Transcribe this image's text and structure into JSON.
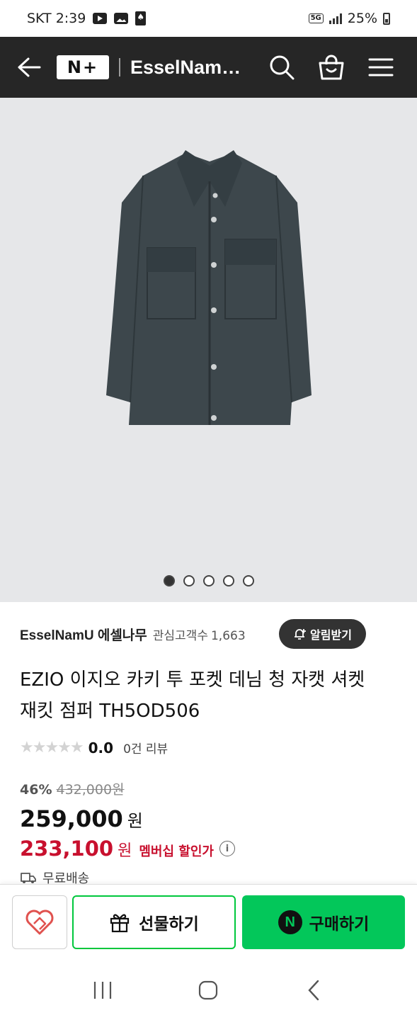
{
  "status_bar": {
    "carrier_time": "SKT 2:39",
    "network": "5G",
    "battery": "25%"
  },
  "header": {
    "logo": "N+",
    "store_title": "EsselNam…",
    "icons": [
      "back-arrow-icon",
      "search-icon",
      "shopping-bag-icon",
      "menu-icon"
    ]
  },
  "gallery": {
    "image_count": 5,
    "active_index": 0
  },
  "store": {
    "name": "EsselNamU 에셀나무",
    "followers_label": "관심고객수",
    "followers_count": "1,663",
    "alarm_label": "알림받기"
  },
  "product": {
    "title_line1": "EZIO 이지오 카키 투 포켓 데님 청 자캣 셔켓",
    "title_line2": "재킷 점퍼 TH5OD506",
    "rating": "0.0",
    "review_count": "0건 리뷰",
    "star_rating_value": 0,
    "discount_rate": "46%",
    "original_price": "432,000원",
    "price": "259,000",
    "price_unit": "원",
    "member_price": "233,100",
    "member_price_unit": "원",
    "member_label": "멤버십 할인가",
    "shipping": "무료배송"
  },
  "actions": {
    "gift_label": "선물하기",
    "buy_label": "구매하기",
    "npay_letter": "N"
  },
  "colors": {
    "header_bg": "#262626",
    "member_red": "#c8102e",
    "buy_green": "#03c75a",
    "wish_red": "#e0524f"
  }
}
